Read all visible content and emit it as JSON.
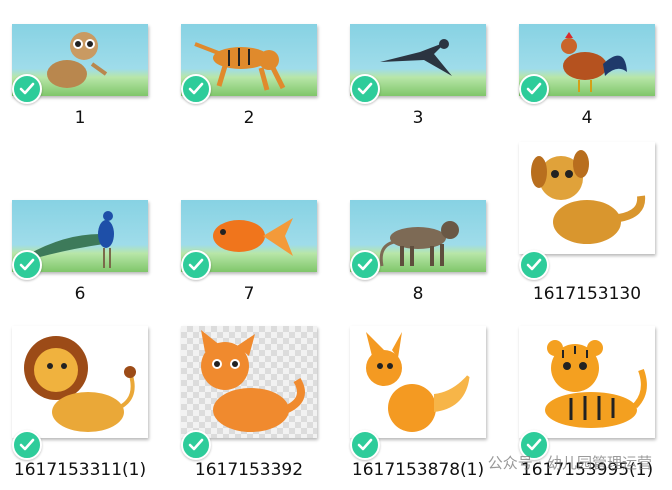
{
  "files": [
    {
      "label": "1",
      "subject": "slow loris"
    },
    {
      "label": "2",
      "subject": "tiger"
    },
    {
      "label": "3",
      "subject": "swallow"
    },
    {
      "label": "4",
      "subject": "rooster"
    },
    {
      "label": "6",
      "subject": "peacock"
    },
    {
      "label": "7",
      "subject": "goldfish"
    },
    {
      "label": "8",
      "subject": "monkey"
    },
    {
      "label": "1617153130",
      "subject": "cartoon dog"
    },
    {
      "label": "1617153311(1)",
      "subject": "cartoon lion"
    },
    {
      "label": "1617153392",
      "subject": "cartoon cat"
    },
    {
      "label": "1617153878(1)",
      "subject": "cartoon fox"
    },
    {
      "label": "1617153995(1)",
      "subject": "cartoon tiger cub"
    }
  ],
  "selection_icon": "check-circle-icon",
  "colors": {
    "check": "#2ecc9a",
    "sky": "#87d2e3",
    "grass": "#7fc66a"
  },
  "watermark": "公众号 · 幼儿园管理运营"
}
